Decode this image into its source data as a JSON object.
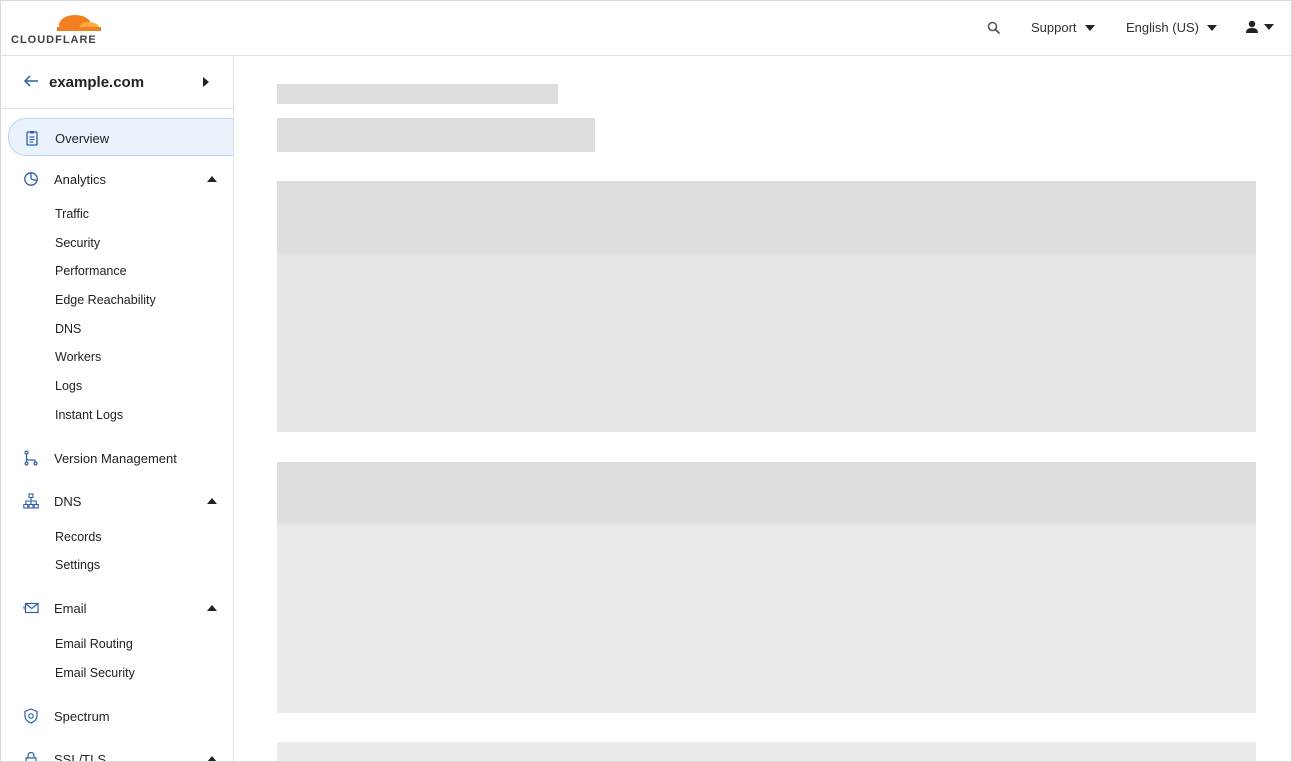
{
  "app": {
    "brand": "CLOUDFLARE",
    "accent_color": "#f38020",
    "icon_color": "#2c5fa3"
  },
  "header": {
    "search_icon": "search-icon",
    "support_label": "Support",
    "language_label": "English (US)",
    "user_icon": "user-icon"
  },
  "sidebar": {
    "zone_name": "example.com",
    "items": [
      {
        "label": "Overview",
        "icon": "clipboard-icon",
        "active": true
      },
      {
        "label": "Analytics",
        "icon": "pie-chart-icon",
        "expanded": true,
        "children": [
          "Traffic",
          "Security",
          "Performance",
          "Edge Reachability",
          "DNS",
          "Workers",
          "Logs",
          "Instant Logs"
        ]
      },
      {
        "label": "Version Management",
        "icon": "branch-icon"
      },
      {
        "label": "DNS",
        "icon": "sitemap-icon",
        "expanded": true,
        "children": [
          "Records",
          "Settings"
        ]
      },
      {
        "label": "Email",
        "icon": "envelope-icon",
        "expanded": true,
        "children": [
          "Email Routing",
          "Email Security"
        ]
      },
      {
        "label": "Spectrum",
        "icon": "shield-icon"
      },
      {
        "label": "SSL/TLS",
        "icon": "lock-icon",
        "expanded": true
      }
    ]
  }
}
